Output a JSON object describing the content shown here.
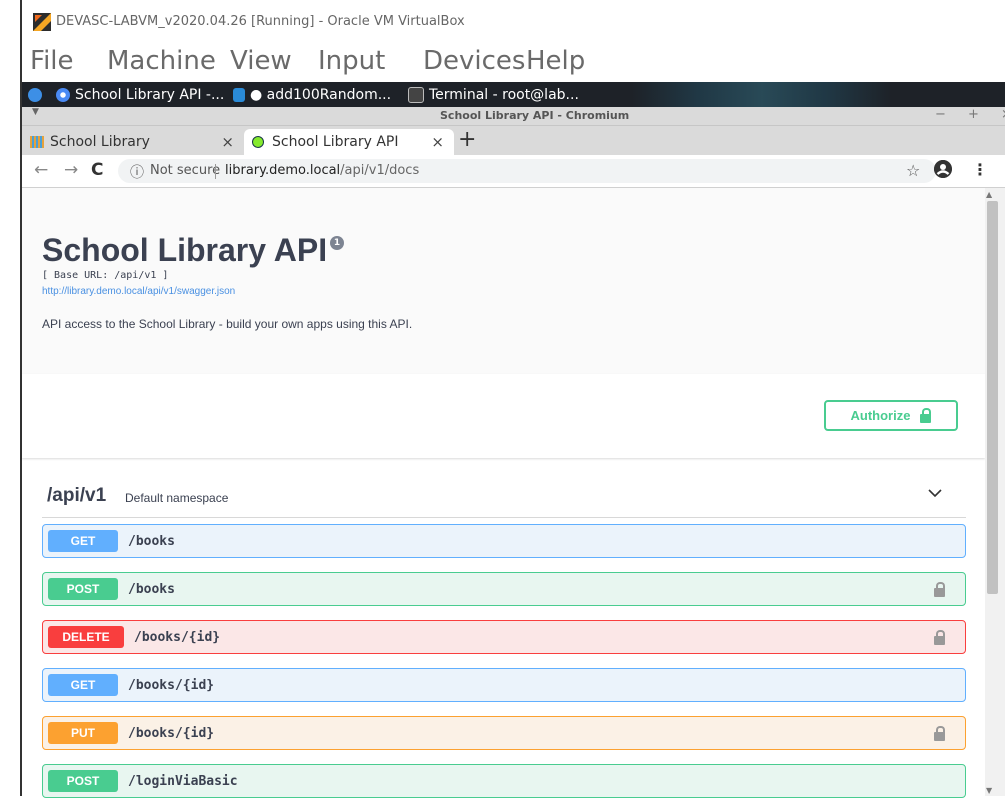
{
  "vbox": {
    "title": "DEVASC-LABVM_v2020.04.26 [Running] - Oracle VM VirtualBox",
    "menu": [
      "File",
      "Machine",
      "View",
      "Input",
      "Devices",
      "Help"
    ]
  },
  "taskbar": {
    "items": [
      {
        "label": "School Library API -...",
        "icon": "chromium-icon"
      },
      {
        "label": "● add100Random...",
        "icon": "vscode-icon"
      },
      {
        "label": "Terminal - root@lab...",
        "icon": "terminal-icon"
      }
    ]
  },
  "chromium": {
    "window_title": "School Library API - Chromium",
    "window_controls": "− + ×",
    "tabs": [
      {
        "label": "School Library",
        "close": "×"
      },
      {
        "label": "School Library API",
        "close": "×"
      }
    ],
    "new_tab": "+",
    "omnibox": {
      "security": "Not secure",
      "host": "library.demo.local",
      "path": "/api/v1/docs"
    }
  },
  "swagger": {
    "title": "School Library API",
    "version_badge": "1",
    "base_url": "[ Base URL: /api/v1 ]",
    "spec_link": "http://library.demo.local/api/v1/swagger.json",
    "description": "API access to the School Library - build your own apps using this API.",
    "authorize_label": "Authorize",
    "namespace": {
      "name": "/api/v1",
      "description": "Default namespace"
    },
    "operations": [
      {
        "method": "GET",
        "path": "/books",
        "locked": false
      },
      {
        "method": "POST",
        "path": "/books",
        "locked": true
      },
      {
        "method": "DELETE",
        "path": "/books/{id}",
        "locked": true
      },
      {
        "method": "GET",
        "path": "/books/{id}",
        "locked": false
      },
      {
        "method": "PUT",
        "path": "/books/{id}",
        "locked": true
      },
      {
        "method": "POST",
        "path": "/loginViaBasic",
        "locked": false
      }
    ]
  },
  "colors": {
    "get": "#61affe",
    "get_bg": "#ebf3fb",
    "post": "#49cc90",
    "post_bg": "#e8f6f0",
    "delete": "#f93e3e",
    "delete_bg": "#fbe7e7",
    "put": "#fca130",
    "put_bg": "#fbf1e6"
  }
}
